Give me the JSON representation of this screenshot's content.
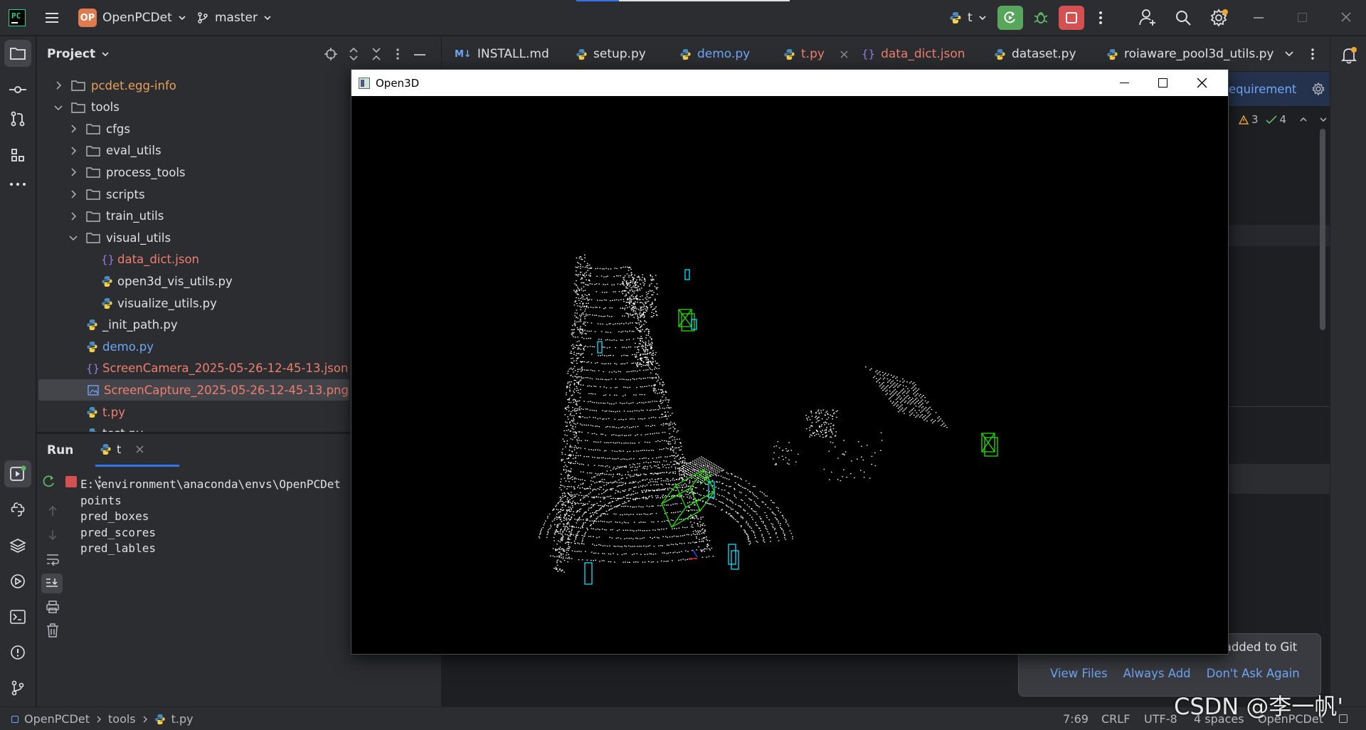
{
  "titlebar": {
    "project_badge": "OP",
    "project_name": "OpenPCDet",
    "branch": "master",
    "run_config": "t",
    "accent": "#e07a50"
  },
  "project_panel": {
    "title": "Project",
    "tree": [
      {
        "label": "pcdet.egg-info",
        "kind": "folder",
        "depth": 1,
        "expanded": false,
        "color": "#e8a15a"
      },
      {
        "label": "tools",
        "kind": "folder",
        "depth": 1,
        "expanded": true,
        "color": "#dfe1e5"
      },
      {
        "label": "cfgs",
        "kind": "folder",
        "depth": 2,
        "expanded": false,
        "color": "#dfe1e5"
      },
      {
        "label": "eval_utils",
        "kind": "folder",
        "depth": 2,
        "expanded": false,
        "color": "#dfe1e5"
      },
      {
        "label": "process_tools",
        "kind": "folder",
        "depth": 2,
        "expanded": false,
        "color": "#dfe1e5"
      },
      {
        "label": "scripts",
        "kind": "folder",
        "depth": 2,
        "expanded": false,
        "color": "#dfe1e5"
      },
      {
        "label": "train_utils",
        "kind": "folder",
        "depth": 2,
        "expanded": false,
        "color": "#dfe1e5"
      },
      {
        "label": "visual_utils",
        "kind": "folder",
        "depth": 2,
        "expanded": true,
        "color": "#dfe1e5"
      },
      {
        "label": "data_dict.json",
        "kind": "json",
        "depth": 3,
        "color": "#f07e6e"
      },
      {
        "label": "open3d_vis_utils.py",
        "kind": "py",
        "depth": 3,
        "color": "#dfe1e5"
      },
      {
        "label": "visualize_utils.py",
        "kind": "py",
        "depth": 3,
        "color": "#dfe1e5"
      },
      {
        "label": "_init_path.py",
        "kind": "py",
        "depth": 2,
        "color": "#dfe1e5"
      },
      {
        "label": "demo.py",
        "kind": "py",
        "depth": 2,
        "color": "#6fa6f8"
      },
      {
        "label": "ScreenCamera_2025-05-26-12-45-13.json",
        "kind": "json",
        "depth": 2,
        "color": "#f07e6e"
      },
      {
        "label": "ScreenCapture_2025-05-26-12-45-13.png",
        "kind": "png",
        "depth": 2,
        "color": "#f07e6e",
        "selected": true
      },
      {
        "label": "t.py",
        "kind": "py",
        "depth": 2,
        "color": "#f07e6e"
      },
      {
        "label": "test.py",
        "kind": "py",
        "depth": 2,
        "color": "#dfe1e5"
      }
    ]
  },
  "run_panel": {
    "title": "Run",
    "tab_label": "t",
    "console_lines": [
      "E:\\environment\\anaconda\\envs\\OpenPCDet",
      "points",
      "pred_boxes",
      "pred_scores",
      "pred_lables"
    ]
  },
  "editor_tabs": [
    {
      "label": "INSTALL.md",
      "icon": "markdown-icon",
      "color": "#dfe1e5"
    },
    {
      "label": "setup.py",
      "icon": "python-icon",
      "color": "#dfe1e5"
    },
    {
      "label": "demo.py",
      "icon": "python-icon",
      "color": "#6fa6f8"
    },
    {
      "label": "t.py",
      "icon": "python-icon",
      "color": "#f07e6e",
      "active": true
    },
    {
      "label": "data_dict.json",
      "icon": "json-icon",
      "color": "#f07e6e"
    },
    {
      "label": "dataset.py",
      "icon": "python-icon",
      "color": "#dfe1e5"
    },
    {
      "label": "roiaware_pool3d_utils.py",
      "icon": "python-icon",
      "color": "#dfe1e5"
    }
  ],
  "editor": {
    "partial_banner": "equirement",
    "warnings": "3",
    "checks": "4"
  },
  "open3d": {
    "title": "Open3D"
  },
  "notification": {
    "message": "Externally added files can be added to Git",
    "actions": [
      "View Files",
      "Always Add",
      "Don't Ask Again"
    ]
  },
  "statusbar": {
    "breadcrumb": [
      "OpenPCDet",
      "tools",
      "t.py"
    ],
    "position": "7:69",
    "line_sep": "CRLF",
    "encoding": "UTF-8",
    "indent": "4 spaces",
    "project": "OpenPCDet"
  },
  "watermark": "CSDN @李一帆'"
}
